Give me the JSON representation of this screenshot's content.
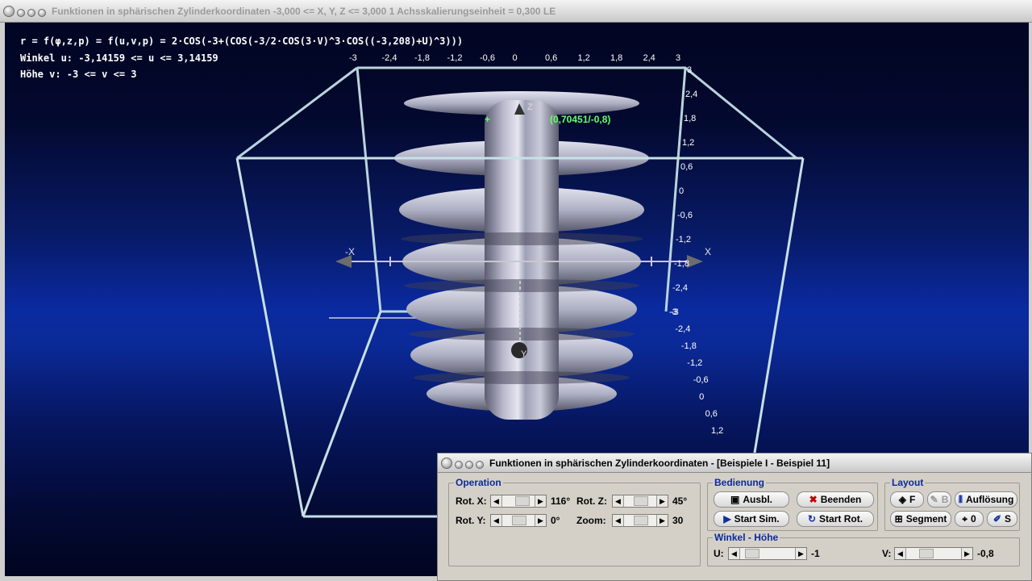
{
  "main_window": {
    "title": "Funktionen in sphärischen Zylinderkoordinaten   -3,000 <= X, Y, Z <= 3,000    1 Achsskalierungseinheit = 0,300 LE"
  },
  "info": {
    "formula": "r = f(φ,z,p) = f(u,v,p) = 2·COS(-3+(COS(-3/2·COS(3·V)^3·COS((-3,208)+U)^3)))",
    "angle_range": "Winkel u: -3,14159 <= u <= 3,14159",
    "height_range": "Höhe v: -3 <= v <= 3"
  },
  "plot": {
    "top_ticks": [
      "-3",
      "-2,4",
      "-1,8",
      "-1,2",
      "-0,6",
      "0",
      "0,6",
      "1,2",
      "1,8",
      "2,4",
      "3"
    ],
    "right_ticks_upper": [
      "3",
      "2,4",
      "1,8",
      "1,2",
      "0,6",
      "0",
      "-0,6",
      "-1,2",
      "-1,8",
      "-2,4",
      "-3"
    ],
    "right_ticks_lower": [
      "-3",
      "-2,4",
      "-1,8",
      "-1,2",
      "-0,6",
      "0",
      "0,6",
      "1,2"
    ],
    "axis_z": "Z",
    "axis_x_pos": "X",
    "axis_x_neg": "-X",
    "axis_y": "Y",
    "point_readout": "(0,70451/-0,8)",
    "colors": {
      "surface": "#b9bacd",
      "box": "#c8e0e6",
      "readout": "#66ff66"
    }
  },
  "panel": {
    "title": "Funktionen in sphärischen Zylinderkoordinaten - [Beispiele I - Beispiel 11]",
    "operation": {
      "label": "Operation",
      "rot_x_label": "Rot. X:",
      "rot_x_value": "116°",
      "rot_y_label": "Rot. Y:",
      "rot_y_value": "0°",
      "rot_z_label": "Rot. Z:",
      "rot_z_value": "45°",
      "zoom_label": "Zoom:",
      "zoom_value": "30"
    },
    "bedienung": {
      "label": "Bedienung",
      "ausbl": "Ausbl.",
      "beenden": "Beenden",
      "start_sim": "Start Sim.",
      "start_rot": "Start Rot."
    },
    "layout": {
      "label": "Layout",
      "f": "F",
      "b": "B",
      "aufloesung": "Auflösung",
      "segment": "Segment",
      "zero": "0",
      "s": "S"
    },
    "winkel": {
      "label": "Winkel - Höhe",
      "u_label": "U:",
      "u_value": "-1",
      "v_label": "V:",
      "v_value": "-0,8"
    }
  }
}
